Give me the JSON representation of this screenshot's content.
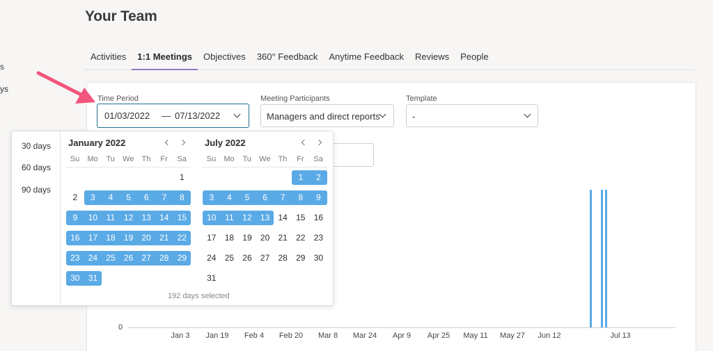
{
  "sidebar_fragments": [
    "s",
    "ys"
  ],
  "page_title": "Your Team",
  "tabs": [
    {
      "label": "Activities",
      "active": false
    },
    {
      "label": "1:1 Meetings",
      "active": true
    },
    {
      "label": "Objectives",
      "active": false
    },
    {
      "label": "360° Feedback",
      "active": false
    },
    {
      "label": "Anytime Feedback",
      "active": false
    },
    {
      "label": "Reviews",
      "active": false
    },
    {
      "label": "People",
      "active": false
    }
  ],
  "filters": {
    "time_period": {
      "label": "Time Period",
      "start": "01/03/2022",
      "separator": "—",
      "end": "07/13/2022"
    },
    "participants": {
      "label": "Meeting Participants",
      "value": "Managers and direct reports"
    },
    "template": {
      "label": "Template",
      "value": "-"
    }
  },
  "date_picker": {
    "presets": [
      "30 days",
      "60 days",
      "90 days"
    ],
    "weekdays": [
      "Su",
      "Mo",
      "Tu",
      "We",
      "Th",
      "Fr",
      "Sa"
    ],
    "months": [
      {
        "title": "January 2022",
        "first_weekday": 6,
        "days_in_month": 31,
        "selected_from": 3,
        "selected_to": 31
      },
      {
        "title": "July 2022",
        "first_weekday": 5,
        "days_in_month": 31,
        "selected_from": 1,
        "selected_to": 13
      }
    ],
    "days_selected_text": "192 days selected"
  },
  "chart_data": {
    "type": "bar",
    "y_ticks": [
      "0"
    ],
    "x_ticks": [
      "Jan 3",
      "Jan 19",
      "Feb 4",
      "Feb 20",
      "Mar 8",
      "Mar 24",
      "Apr 9",
      "Apr 25",
      "May 11",
      "May 27",
      "Jun 12",
      "Jul 13"
    ],
    "bar_dates": [
      "Jul 6",
      "Jul 8",
      "Jul 9"
    ],
    "bar_color": "#5aaae6"
  },
  "colors": {
    "accent": "#5aaae6",
    "tab_underline": "#8e7cc3",
    "arrow": "#f2557d",
    "focus_border": "#1f6f8b"
  }
}
